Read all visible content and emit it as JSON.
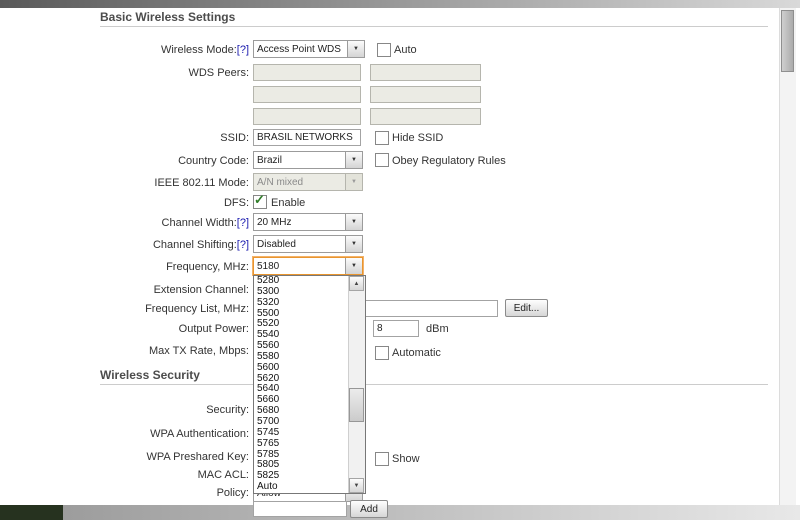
{
  "sections": {
    "basic": "Basic Wireless Settings",
    "security": "Wireless Security"
  },
  "colors": {
    "focus_border": "#E8952F",
    "help_link": "#1A1AAE"
  },
  "form": {
    "wireless_mode": {
      "label": "Wireless Mode:",
      "help": "[?]",
      "value": "Access Point WDS",
      "auto_checkbox": "Auto",
      "auto_checked": false
    },
    "wds_peers": {
      "label": "WDS Peers:",
      "values": [
        "",
        "",
        "",
        "",
        "",
        ""
      ]
    },
    "ssid": {
      "label": "SSID:",
      "value": "BRASIL NETWORKS",
      "hide_checkbox": "Hide SSID",
      "hide_checked": false
    },
    "country_code": {
      "label": "Country Code:",
      "value": "Brazil",
      "obey_checkbox": "Obey Regulatory Rules",
      "obey_checked": false
    },
    "ieee_mode": {
      "label": "IEEE 802.11 Mode:",
      "value": "A/N mixed",
      "disabled": true
    },
    "dfs": {
      "label": "DFS:",
      "enable_checkbox": "Enable",
      "enable_checked": true
    },
    "channel_width": {
      "label": "Channel Width:",
      "help": "[?]",
      "value": "20 MHz"
    },
    "channel_shifting": {
      "label": "Channel Shifting:",
      "help": "[?]",
      "value": "Disabled"
    },
    "frequency": {
      "label": "Frequency, MHz:",
      "value": "5180",
      "focused": true
    },
    "extension_channel": {
      "label": "Extension Channel:"
    },
    "frequency_list": {
      "label": "Frequency List, MHz:",
      "value": "",
      "edit_button": "Edit..."
    },
    "output_power": {
      "label": "Output Power:",
      "value": "8",
      "unit": "dBm"
    },
    "max_tx_rate": {
      "label": "Max TX Rate, Mbps:",
      "auto_checkbox": "Automatic",
      "auto_checked": false
    },
    "security": {
      "label": "Security:"
    },
    "wpa_authentication": {
      "label": "WPA Authentication:"
    },
    "wpa_preshared_key": {
      "label": "WPA Preshared Key:",
      "show_checkbox": "Show",
      "show_checked": false
    },
    "mac_acl": {
      "label": "MAC ACL:"
    },
    "policy": {
      "label": "Policy:",
      "value": "Allow"
    },
    "add_button": "Add"
  },
  "frequency_dropdown": {
    "open": true,
    "options": [
      "5280",
      "5300",
      "5320",
      "5500",
      "5520",
      "5540",
      "5560",
      "5580",
      "5600",
      "5620",
      "5640",
      "5660",
      "5680",
      "5700",
      "5745",
      "5765",
      "5785",
      "5805",
      "5825",
      "Auto"
    ]
  }
}
